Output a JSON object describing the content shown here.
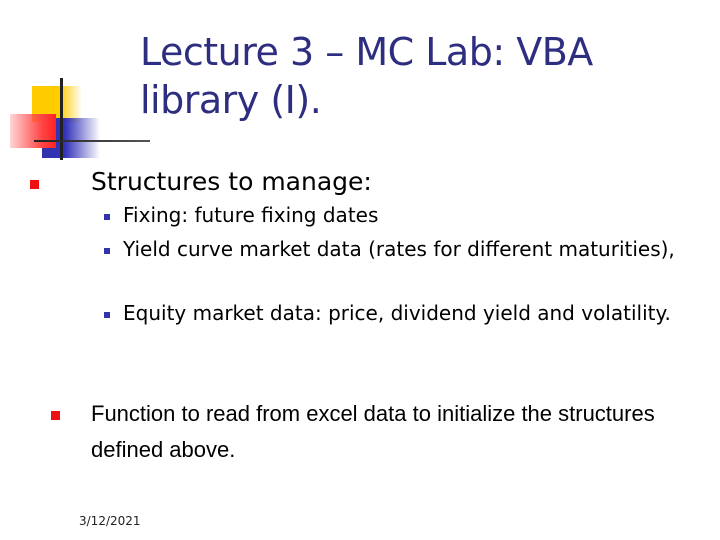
{
  "slide": {
    "title": "Lecture 3 – MC Lab: VBA library (I).",
    "bullets": [
      {
        "text": "Structures to manage:",
        "sub_bullets": [
          "Fixing: future fixing dates",
          "Yield curve market data (rates for different maturities),",
          "Equity market data: price, dividend yield and volatility."
        ]
      },
      {
        "text": "Function to read from excel data to initialize the structures defined above.",
        "sub_bullets": []
      }
    ],
    "date": "3/12/2021"
  },
  "colors": {
    "title": "#2e2e80",
    "bullet_level1": "#ee1111",
    "bullet_level2": "#3333aa",
    "deco_yellow": "#ffcc00",
    "deco_blue": "#3333bb",
    "deco_red": "#ff4444"
  }
}
